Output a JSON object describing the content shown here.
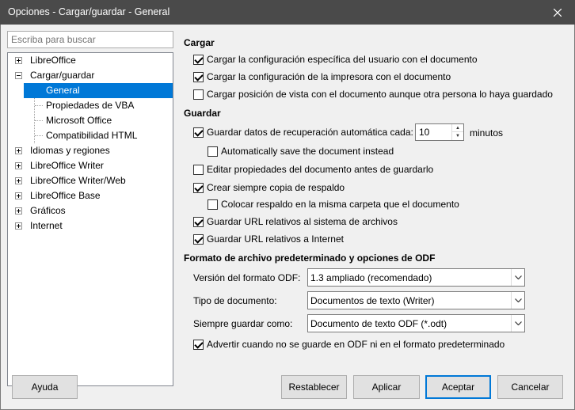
{
  "window": {
    "title": "Opciones - Cargar/guardar - General"
  },
  "search": {
    "placeholder": "Escriba para buscar"
  },
  "tree": {
    "items": [
      {
        "label": "LibreOffice",
        "expander": "plus"
      },
      {
        "label": "Cargar/guardar",
        "expander": "minus"
      },
      {
        "label": "General",
        "selected": true
      },
      {
        "label": "Propiedades de VBA"
      },
      {
        "label": "Microsoft Office"
      },
      {
        "label": "Compatibilidad HTML"
      },
      {
        "label": "Idiomas y regiones",
        "expander": "plus"
      },
      {
        "label": "LibreOffice Writer",
        "expander": "plus"
      },
      {
        "label": "LibreOffice Writer/Web",
        "expander": "plus"
      },
      {
        "label": "LibreOffice Base",
        "expander": "plus"
      },
      {
        "label": "Gráficos",
        "expander": "plus"
      },
      {
        "label": "Internet",
        "expander": "plus"
      }
    ]
  },
  "cargar": {
    "heading": "Cargar",
    "options": [
      {
        "label": "Cargar la configuración específica del usuario con el documento",
        "checked": true
      },
      {
        "label": "Cargar la configuración de la impresora con el documento",
        "checked": true
      },
      {
        "label": "Cargar posición de vista con el documento aunque otra persona lo haya guardado",
        "checked": false
      }
    ]
  },
  "guardar": {
    "heading": "Guardar",
    "autosave": {
      "label": "Guardar datos de recuperación automática cada:",
      "checked": true,
      "value": "10",
      "unit": "minutos"
    },
    "options": [
      {
        "label": "Automatically save the document instead",
        "checked": false
      },
      {
        "label": "Editar propiedades del documento antes de guardarlo",
        "checked": false
      },
      {
        "label": "Crear siempre copia de respaldo",
        "checked": true
      },
      {
        "label": "Colocar respaldo en la misma carpeta que el documento",
        "checked": false
      },
      {
        "label": "Guardar URL relativos al sistema de archivos",
        "checked": true
      },
      {
        "label": "Guardar URL relativos a Internet",
        "checked": true
      }
    ]
  },
  "formato": {
    "heading": "Formato de archivo predeterminado y opciones de ODF",
    "version_label": "Versión del formato ODF:",
    "version_value": "1.3 ampliado (recomendado)",
    "doctype_label": "Tipo de documento:",
    "doctype_value": "Documentos de texto (Writer)",
    "saveas_label": "Siempre guardar como:",
    "saveas_value": "Documento de texto ODF (*.odt)",
    "warn": {
      "label": "Advertir cuando no se guarde en ODF ni en el formato predeterminado",
      "checked": true
    }
  },
  "buttons": {
    "help": "Ayuda",
    "reset": "Restablecer",
    "apply": "Aplicar",
    "ok": "Aceptar",
    "cancel": "Cancelar"
  }
}
